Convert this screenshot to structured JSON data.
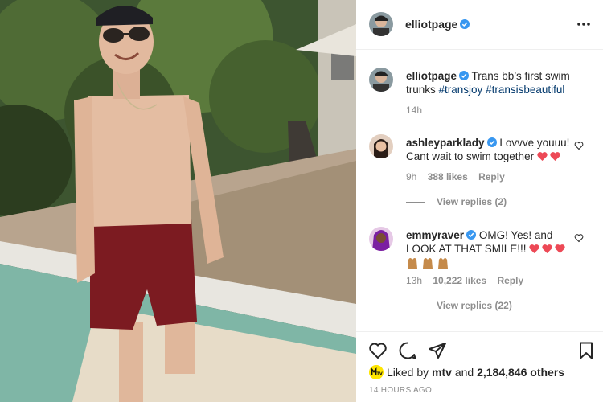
{
  "post": {
    "author": "elliotpage",
    "verified": true,
    "caption_text": "Trans bb’s first swim trunks",
    "hashtags": [
      "#transjoy",
      "#transisbeautiful"
    ],
    "caption_age": "14h",
    "more_icon": "more-horizontal-icon"
  },
  "comments": [
    {
      "username": "ashleyparklady",
      "verified": true,
      "text_line1": "Lovvve youuu!",
      "text_line2": "Cant wait to swim together",
      "emoji_hearts": 2,
      "age": "9h",
      "likes": "388 likes",
      "reply_label": "Reply",
      "view_replies": "View replies (2)"
    },
    {
      "username": "emmyraver",
      "verified": true,
      "text_line1": "OMG! Yes! and",
      "text_line2": "LOOK AT THAT SMILE!!!",
      "emoji_hearts": 3,
      "emoji_hands": 3,
      "age": "13h",
      "likes": "10,222 likes",
      "reply_label": "Reply",
      "view_replies": "View replies (22)"
    }
  ],
  "footer": {
    "liked_by_prefix": "Liked by",
    "liked_by_user": "mtv",
    "liked_by_and": "and",
    "liked_by_count": "2,184,846 others",
    "timestamp": "14 HOURS AGO",
    "icons": [
      "heart-icon",
      "comment-icon",
      "share-icon",
      "bookmark-icon"
    ]
  },
  "colors": {
    "verified_blue": "#3897f0",
    "heart_red": "#ed4956",
    "hashtag": "#00376b",
    "muted": "#8e8e8e",
    "mtv_yellow": "#ffe600"
  }
}
